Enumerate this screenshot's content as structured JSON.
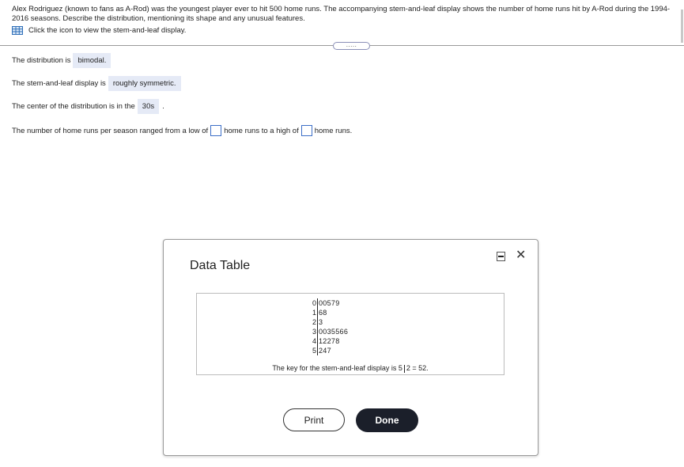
{
  "question": {
    "intro": "Alex Rodriguez (known to fans as A-Rod) was the youngest player ever to hit 500 home runs. The accompanying stem-and-leaf display shows the number of home runs hit by A-Rod during the 1994-2016 seasons. Describe the distribution, mentioning its shape and any unusual features.",
    "icon_link": "Click the icon to view the stem-and-leaf display.",
    "expand_label": "....."
  },
  "answers": {
    "q1_prefix": "The distribution is",
    "q1_answer": "bimodal.",
    "q2_prefix": "The stem-and-leaf display is",
    "q2_answer": "roughly symmetric.",
    "q3_prefix": "The center of the distribution is in the",
    "q3_answer": "30s",
    "q3_suffix": ".",
    "q4_prefix": "The number of home runs per season ranged from a low of",
    "q4_middle": "home runs to a high of",
    "q4_suffix": "home runs."
  },
  "dialog": {
    "title": "Data Table",
    "close_symbol": "✕",
    "stem_leaf": [
      {
        "stem": "0",
        "leaves": "00579"
      },
      {
        "stem": "1",
        "leaves": "68"
      },
      {
        "stem": "2",
        "leaves": "3"
      },
      {
        "stem": "3",
        "leaves": "0035566"
      },
      {
        "stem": "4",
        "leaves": "12278"
      },
      {
        "stem": "5",
        "leaves": "247"
      }
    ],
    "key_prefix": "The key for the stem-and-leaf display is 5",
    "key_suffix": "2 = 52.",
    "print_label": "Print",
    "done_label": "Done"
  },
  "colors": {
    "answer_bg": "#e5eaf6",
    "input_border": "#3d6fc7",
    "done_bg": "#1b1f2a",
    "icon_blue": "#2f6fb8"
  }
}
